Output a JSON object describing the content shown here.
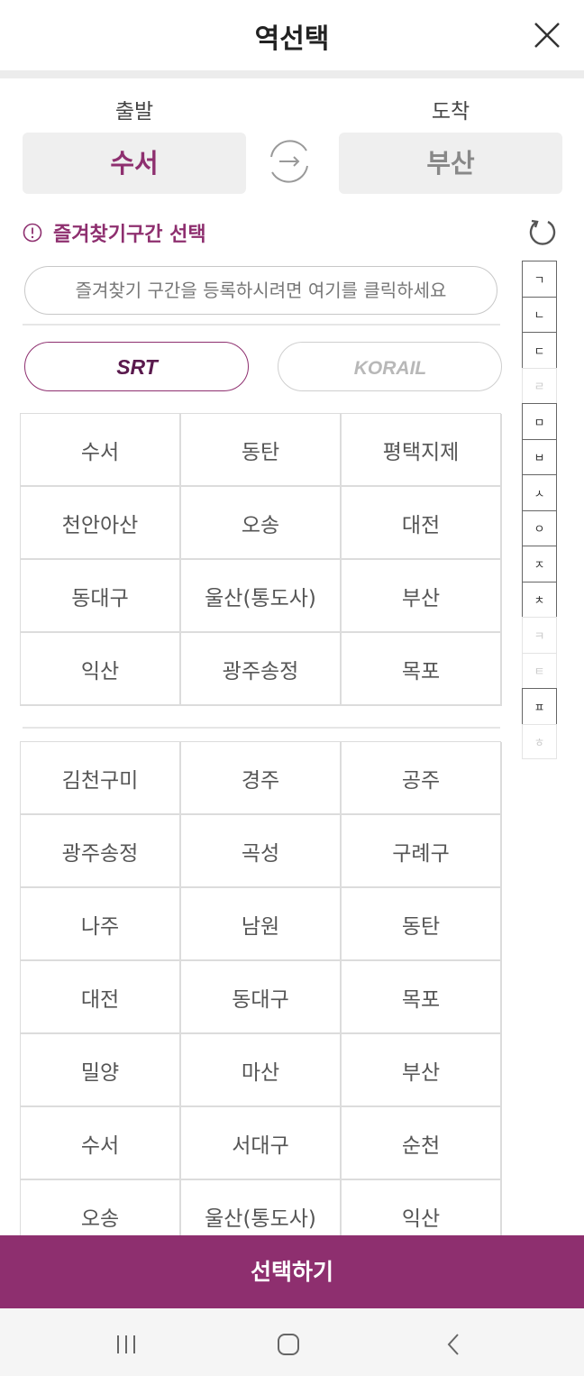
{
  "header": {
    "title": "역선택"
  },
  "route": {
    "departure_label": "출발",
    "arrival_label": "도착",
    "departure": "수서",
    "arrival": "부산"
  },
  "favorites": {
    "title": "즐겨찾기구간 선택",
    "placeholder": "즐겨찾기 구간을 등록하시려면 여기를 클릭하세요"
  },
  "carriers": [
    {
      "label": "SRT",
      "selected": true
    },
    {
      "label": "KORAIL",
      "selected": false
    }
  ],
  "main_stations": [
    "수서",
    "동탄",
    "평택지제",
    "천안아산",
    "오송",
    "대전",
    "동대구",
    "울산(통도사)",
    "부산",
    "익산",
    "광주송정",
    "목포"
  ],
  "all_stations": [
    "김천구미",
    "경주",
    "공주",
    "광주송정",
    "곡성",
    "구례구",
    "나주",
    "남원",
    "동탄",
    "대전",
    "동대구",
    "목포",
    "밀양",
    "마산",
    "부산",
    "수서",
    "서대구",
    "순천",
    "오송",
    "울산(통도사)",
    "익산"
  ],
  "index_bar": [
    {
      "label": "ㄱ",
      "enabled": true
    },
    {
      "label": "ㄴ",
      "enabled": true
    },
    {
      "label": "ㄷ",
      "enabled": true
    },
    {
      "label": "ㄹ",
      "enabled": false
    },
    {
      "label": "ㅁ",
      "enabled": true
    },
    {
      "label": "ㅂ",
      "enabled": true
    },
    {
      "label": "ㅅ",
      "enabled": true
    },
    {
      "label": "ㅇ",
      "enabled": true
    },
    {
      "label": "ㅈ",
      "enabled": true
    },
    {
      "label": "ㅊ",
      "enabled": true
    },
    {
      "label": "ㅋ",
      "enabled": false
    },
    {
      "label": "ㅌ",
      "enabled": false
    },
    {
      "label": "ㅍ",
      "enabled": true
    },
    {
      "label": "ㅎ",
      "enabled": false
    }
  ],
  "select_button": "선택하기",
  "colors": {
    "brand": "#8e2f6f",
    "muted_text": "#888888",
    "panel_gray": "#efefef"
  }
}
